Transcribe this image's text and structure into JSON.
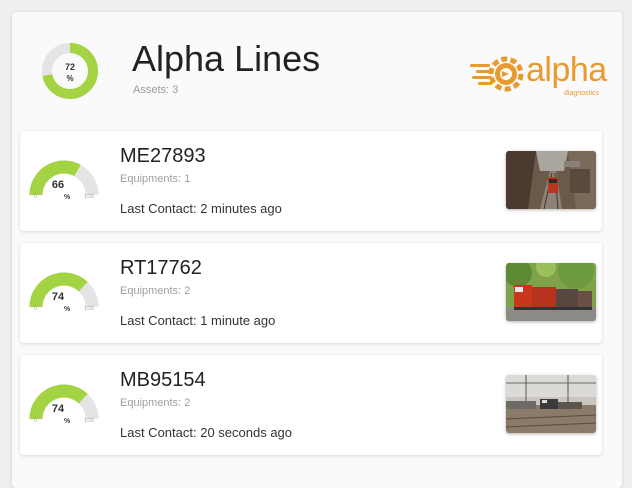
{
  "header": {
    "percent": 72,
    "percent_display": "72",
    "unit": "%",
    "title": "Alpha Lines",
    "subtitle": "Assets: 3",
    "logo_text": "alpha",
    "logo_sub": "diagnostics"
  },
  "colors": {
    "accent_green": "#a4d344",
    "track_gray": "#e4e4e4",
    "brand_orange": "#e89a2e"
  },
  "assets": [
    {
      "name": "ME27893",
      "equipments": "Equipments: 1",
      "last_contact": "Last Contact: 2 minutes ago",
      "gauge_value": 66,
      "gauge_display": "66",
      "unit": "%",
      "min": "0",
      "max": "100",
      "image": "train-canyon-photo"
    },
    {
      "name": "RT17762",
      "equipments": "Equipments: 2",
      "last_contact": "Last Contact: 1 minute ago",
      "gauge_value": 74,
      "gauge_display": "74",
      "unit": "%",
      "min": "0",
      "max": "100",
      "image": "train-forest-photo"
    },
    {
      "name": "MB95154",
      "equipments": "Equipments: 2",
      "last_contact": "Last Contact: 20 seconds ago",
      "gauge_value": 74,
      "gauge_display": "74",
      "unit": "%",
      "min": "0",
      "max": "100",
      "image": "train-yard-photo"
    }
  ]
}
